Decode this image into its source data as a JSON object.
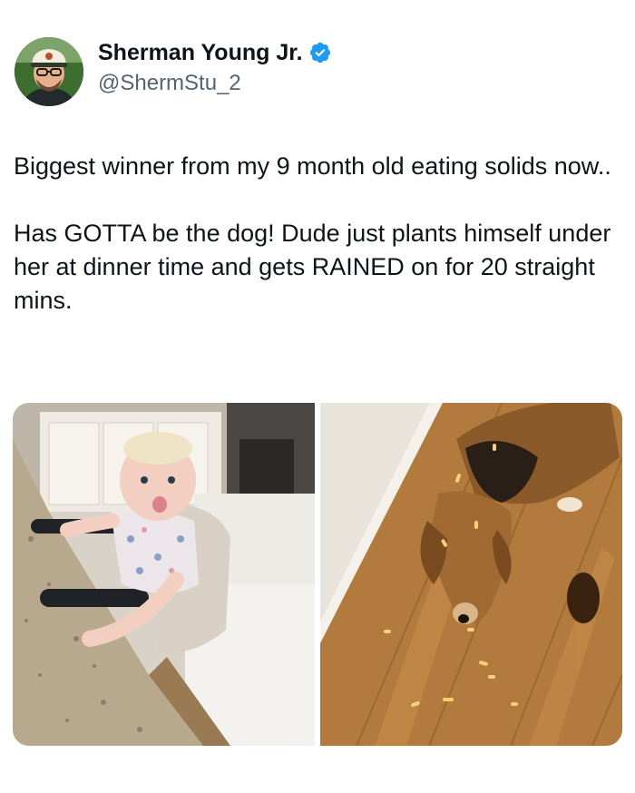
{
  "author": {
    "display_name": "Sherman Young Jr.",
    "handle": "@ShermStu_2",
    "verified": true,
    "avatar_icon": "user-avatar",
    "verified_icon": "verified-badge-icon",
    "verified_color": "#1d9bf0"
  },
  "tweet": {
    "paragraphs": [
      "Biggest winner from my 9 month old eating solids now..",
      "Has GOTTA be the dog! Dude just plants himself under her at dinner time and gets RAINED on for 20 straight mins."
    ]
  },
  "media": [
    {
      "icon": "baby-photo"
    },
    {
      "icon": "dog-photo"
    }
  ],
  "colors": {
    "text": "#0f1419",
    "secondary_text": "#536471",
    "background": "#ffffff"
  }
}
